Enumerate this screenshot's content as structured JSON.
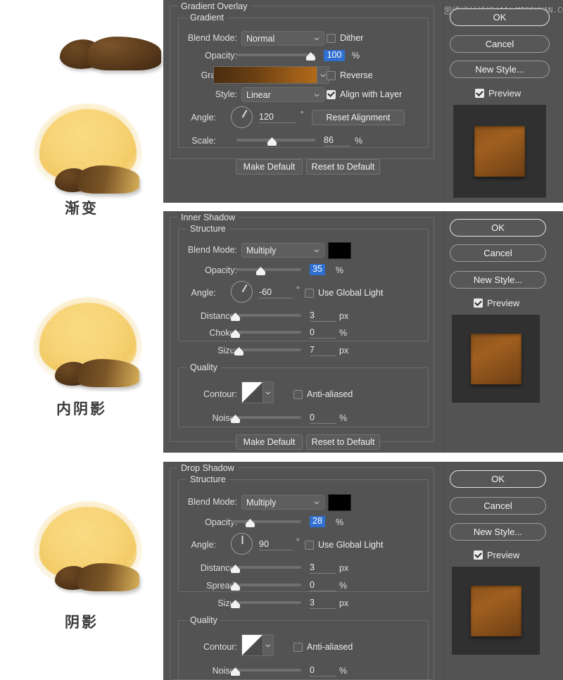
{
  "watermark": {
    "cn": "思缘设计论坛",
    "url": "WWW.MISSYUAN.COM"
  },
  "illustrations": [
    {
      "caption": ""
    },
    {
      "caption": "渐变"
    },
    {
      "caption": "内阴影"
    },
    {
      "caption": "阴影"
    }
  ],
  "dialogs": [
    {
      "title": "Gradient Overlay",
      "section_label": "Gradient",
      "rows": {
        "blend_mode_label": "Blend Mode:",
        "blend_mode_value": "Normal",
        "dither_label": "Dither",
        "dither_checked": false,
        "opacity_label": "Opacity:",
        "opacity_value": "100",
        "opacity_unit": "%",
        "opacity_percent": 100,
        "gradient_label": "Gradient:",
        "gradient_from": "#4a2c10",
        "gradient_to": "#b06a18",
        "reverse_label": "Reverse",
        "reverse_checked": false,
        "style_label": "Style:",
        "style_value": "Linear",
        "align_label": "Align with Layer",
        "align_checked": true,
        "angle_label": "Angle:",
        "angle_value": "120",
        "angle_unit": "°",
        "reset_alignment_label": "Reset Alignment",
        "scale_label": "Scale:",
        "scale_value": "86",
        "scale_unit": "%",
        "scale_percent": 40
      },
      "make_default_label": "Make Default",
      "reset_default_label": "Reset to Default",
      "buttons": {
        "ok": "OK",
        "cancel": "Cancel",
        "new_style": "New Style...",
        "preview": "Preview",
        "preview_checked": true
      }
    },
    {
      "title": "Inner Shadow",
      "section_label": "Structure",
      "quality_label": "Quality",
      "rows": {
        "blend_mode_label": "Blend Mode:",
        "blend_mode_value": "Multiply",
        "color_swatch": "#000000",
        "opacity_label": "Opacity:",
        "opacity_value": "35",
        "opacity_unit": "%",
        "opacity_percent": 35,
        "angle_label": "Angle:",
        "angle_value": "-60",
        "angle_unit": "°",
        "global_light_label": "Use Global Light",
        "global_light_checked": false,
        "distance_label": "Distance:",
        "distance_value": "3",
        "distance_unit": "px",
        "distance_percent": 3,
        "choke_label": "Choke:",
        "choke_value": "0",
        "choke_unit": "%",
        "choke_percent": 0,
        "size_label": "Size:",
        "size_value": "7",
        "size_unit": "px",
        "size_percent": 5,
        "contour_label": "Contour:",
        "antialiased_label": "Anti-aliased",
        "antialiased_checked": false,
        "noise_label": "Noise:",
        "noise_value": "0",
        "noise_unit": "%",
        "noise_percent": 0
      },
      "make_default_label": "Make Default",
      "reset_default_label": "Reset to Default",
      "buttons": {
        "ok": "OK",
        "cancel": "Cancel",
        "new_style": "New Style...",
        "preview": "Preview",
        "preview_checked": true
      }
    },
    {
      "title": "Drop Shadow",
      "section_label": "Structure",
      "quality_label": "Quality",
      "rows": {
        "blend_mode_label": "Blend Mode:",
        "blend_mode_value": "Multiply",
        "color_swatch": "#000000",
        "opacity_label": "Opacity:",
        "opacity_value": "28",
        "opacity_unit": "%",
        "opacity_percent": 28,
        "angle_label": "Angle:",
        "angle_value": "90",
        "angle_unit": "°",
        "global_light_label": "Use Global Light",
        "global_light_checked": false,
        "distance_label": "Distance:",
        "distance_value": "3",
        "distance_unit": "px",
        "distance_percent": 3,
        "spread_label": "Spread:",
        "spread_value": "0",
        "spread_unit": "%",
        "spread_percent": 0,
        "size_label": "Size:",
        "size_value": "3",
        "size_unit": "px",
        "size_percent": 3,
        "contour_label": "Contour:",
        "antialiased_label": "Anti-aliased",
        "antialiased_checked": false,
        "noise_label": "Noise:",
        "noise_value": "0",
        "noise_unit": "%",
        "noise_percent": 0
      },
      "buttons": {
        "ok": "OK",
        "cancel": "Cancel",
        "new_style": "New Style...",
        "preview": "Preview",
        "preview_checked": true
      }
    }
  ]
}
